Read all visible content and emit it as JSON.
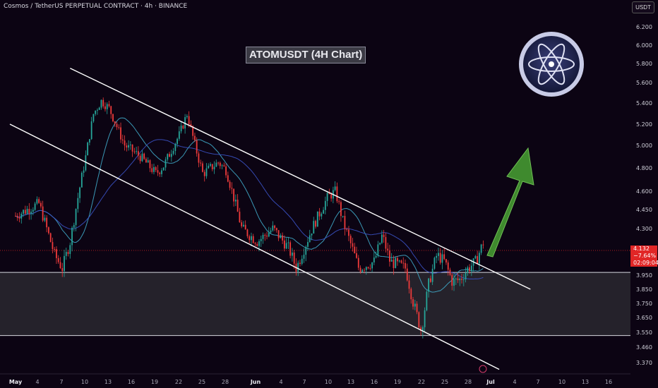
{
  "header": {
    "instrument": "Cosmos / TetherUS PERPETUAL CONTRACT · 4h · BINANCE",
    "currency_button": "USDT"
  },
  "annotation_title": "ATOMUSDT (4H Chart)",
  "price_badge": {
    "price": "4.132",
    "change": "−7.64%",
    "countdown": "02:09:04"
  },
  "colors": {
    "background": "#0c0413",
    "bull": "#26a69a",
    "bear": "#ef3b3b",
    "channel": "#ffffff",
    "ma_fast": "#3fa8c8",
    "ma_slow": "#3a52c4",
    "arrow": "#3f8a2e",
    "zone": "#2a2830"
  },
  "logo": "cosmos-atom-logo",
  "chart_data": {
    "type": "candlestick",
    "x_ticks": [
      "May",
      "4",
      "7",
      "10",
      "13",
      "16",
      "19",
      "22",
      "25",
      "28",
      "Jun",
      "4",
      "7",
      "10",
      "13",
      "16",
      "19",
      "22",
      "25",
      "28",
      "Jul",
      "4",
      "7",
      "10",
      "13",
      "16"
    ],
    "y_ticks": [
      "6.200",
      "6.000",
      "5.800",
      "5.600",
      "5.400",
      "5.200",
      "5.000",
      "4.800",
      "4.600",
      "4.450",
      "4.300",
      "4.132",
      "3.950",
      "3.850",
      "3.750",
      "3.650",
      "3.550",
      "3.460",
      "3.370"
    ],
    "last_price": 4.132,
    "support_zone": [
      3.53,
      3.97
    ],
    "channel": {
      "upper": [
        [
          "May 8",
          5.75
        ],
        [
          "Jul 6",
          3.85
        ]
      ],
      "lower": [
        [
          "May 1",
          5.2
        ],
        [
          "Jul 2",
          3.33
        ]
      ]
    },
    "price_path": [
      [
        "May 1",
        4.4
      ],
      [
        "May 4",
        4.5
      ],
      [
        "May 6",
        4.1
      ],
      [
        "May 7",
        4.0
      ],
      [
        "May 8",
        4.2
      ],
      [
        "May 10",
        4.9
      ],
      [
        "May 11",
        5.3
      ],
      [
        "May 12",
        5.42
      ],
      [
        "May 13",
        5.35
      ],
      [
        "May 15",
        5.0
      ],
      [
        "May 17",
        4.9
      ],
      [
        "May 19",
        4.75
      ],
      [
        "May 20",
        4.82
      ],
      [
        "May 22",
        5.1
      ],
      [
        "May 23",
        5.3
      ],
      [
        "May 24",
        5.0
      ],
      [
        "May 25",
        4.75
      ],
      [
        "May 27",
        4.85
      ],
      [
        "May 28",
        4.78
      ],
      [
        "May 30",
        4.3
      ],
      [
        "Jun 1",
        4.2
      ],
      [
        "Jun 3",
        4.3
      ],
      [
        "Jun 5",
        4.15
      ],
      [
        "Jun 6",
        4.0
      ],
      [
        "Jun 8",
        4.3
      ],
      [
        "Jun 10",
        4.55
      ],
      [
        "Jun 11",
        4.6
      ],
      [
        "Jun 12",
        4.35
      ],
      [
        "Jun 14",
        4.0
      ],
      [
        "Jun 16",
        4.05
      ],
      [
        "Jun 17",
        4.25
      ],
      [
        "Jun 18",
        4.05
      ],
      [
        "Jun 20",
        4.0
      ],
      [
        "Jun 21",
        3.75
      ],
      [
        "Jun 22",
        3.56
      ],
      [
        "Jun 23",
        3.9
      ],
      [
        "Jun 24",
        4.1
      ],
      [
        "Jun 25",
        4.05
      ],
      [
        "Jun 26",
        3.9
      ],
      [
        "Jun 27",
        3.92
      ],
      [
        "Jun 28",
        4.0
      ],
      [
        "Jun 29",
        4.05
      ],
      [
        "Jun 30",
        4.2
      ]
    ]
  }
}
